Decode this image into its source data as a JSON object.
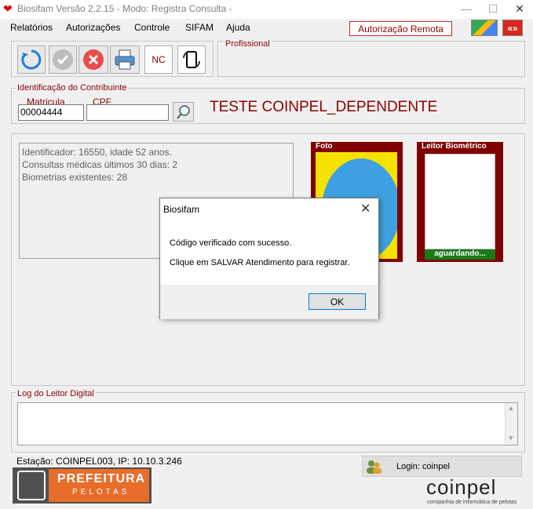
{
  "window": {
    "title": "Biosifam Versão 2.2.15 - Modo: Registra Consulta -",
    "minimize": "—",
    "maximize": "☐",
    "close": "✕"
  },
  "menu": {
    "items": [
      "Relatórios",
      "Autorizações",
      "Controle",
      "SIFAM",
      "Ajuda"
    ],
    "remote_button": "Autorização Remota"
  },
  "toolbar": {
    "nc_label": "NC",
    "profissional_label": "Profissional"
  },
  "contribuinte": {
    "group_label": "Identificação do Contribuinte",
    "matricula_label": "Matricula",
    "matricula_value": "00004444",
    "cpf_label": "CPF",
    "cpf_value": "",
    "name": "TESTE COINPEL_DEPENDENTE"
  },
  "info": {
    "lines": [
      "Identificador: 16550, idade 52 anos.",
      "Consultas médicas últimos 30 dias: 2",
      "Biometrias existentes: 28"
    ]
  },
  "foto": {
    "label": "Foto"
  },
  "leitor": {
    "label": "Leitor Biométrico",
    "status": "aguardando..."
  },
  "log": {
    "label": "Log do Leitor Digital",
    "content": ""
  },
  "status": {
    "estacao": "Estação: COINPEL003, IP: 10.10.3.246",
    "login": "Login: coinpel"
  },
  "logos": {
    "prefeitura": "PREFEITURA",
    "pelotas": "PELOTAS",
    "coinpel": "coinpel",
    "coinpel_sub": "companhia de informática de pelotas"
  },
  "dialog": {
    "title": "Biosifam",
    "message1": "Código verificado com sucesso.",
    "message2": "Clique em SALVAR Atendimento para registrar.",
    "ok_label": "OK"
  },
  "colors": {
    "accent": "#8b0000",
    "foto_frame": "#800000",
    "leitor_status": "#006400"
  }
}
